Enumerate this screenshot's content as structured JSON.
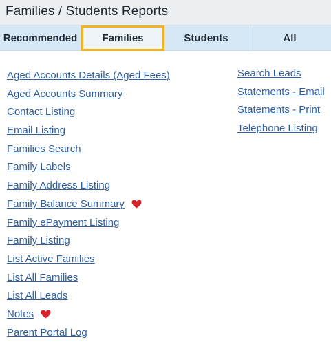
{
  "header": {
    "title": "Families / Students Reports"
  },
  "tabs": [
    {
      "label": "Recommended"
    },
    {
      "label": "Families"
    },
    {
      "label": "Students"
    },
    {
      "label": "All"
    }
  ],
  "reports_left": [
    "Aged Accounts Details (Aged Fees)",
    "Aged Accounts Summary",
    "Contact Listing",
    "Email Listing",
    "Families Search",
    "Family Labels",
    "Family Address Listing",
    "Family Balance Summary",
    "Family ePayment Listing",
    "Family Listing",
    "List Active Families",
    "List All Families",
    "List All Leads",
    "Notes",
    "Parent Portal Log"
  ],
  "reports_right": [
    "Search Leads",
    "Statements - Email",
    "Statements - Print",
    "Telephone Listing"
  ],
  "favorite_color": "#d8232a",
  "active_tab_border": "#f0b323",
  "link_color": "#2f5fa0"
}
